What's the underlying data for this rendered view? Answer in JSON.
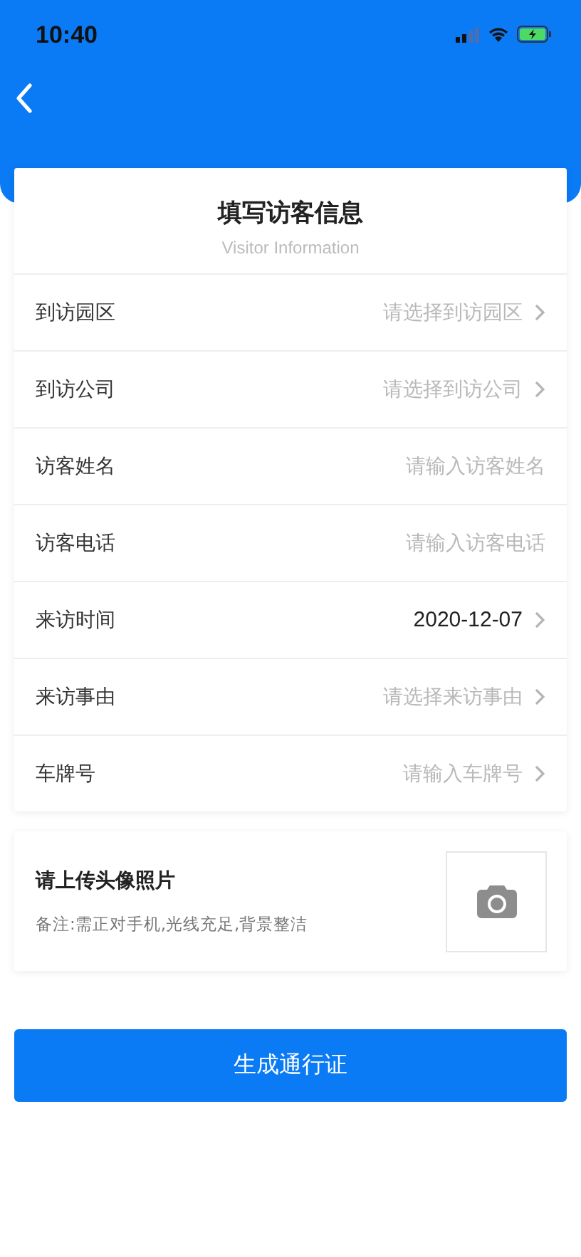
{
  "status_bar": {
    "time": "10:40"
  },
  "form": {
    "title": "填写访客信息",
    "subtitle": "Visitor Information",
    "rows": [
      {
        "label": "到访园区",
        "kind": "select",
        "placeholder": "请选择到访园区"
      },
      {
        "label": "到访公司",
        "kind": "select",
        "placeholder": "请选择到访公司"
      },
      {
        "label": "访客姓名",
        "kind": "input",
        "placeholder": "请输入访客姓名"
      },
      {
        "label": "访客电话",
        "kind": "input",
        "placeholder": "请输入访客电话"
      },
      {
        "label": "来访时间",
        "kind": "select",
        "value": "2020-12-07"
      },
      {
        "label": "来访事由",
        "kind": "select",
        "placeholder": "请选择来访事由"
      },
      {
        "label": "车牌号",
        "kind": "select",
        "placeholder": "请输入车牌号"
      }
    ]
  },
  "photo": {
    "title": "请上传头像照片",
    "note": "备注:需正对手机,光线充足,背景整洁"
  },
  "submit_button": "生成通行证"
}
